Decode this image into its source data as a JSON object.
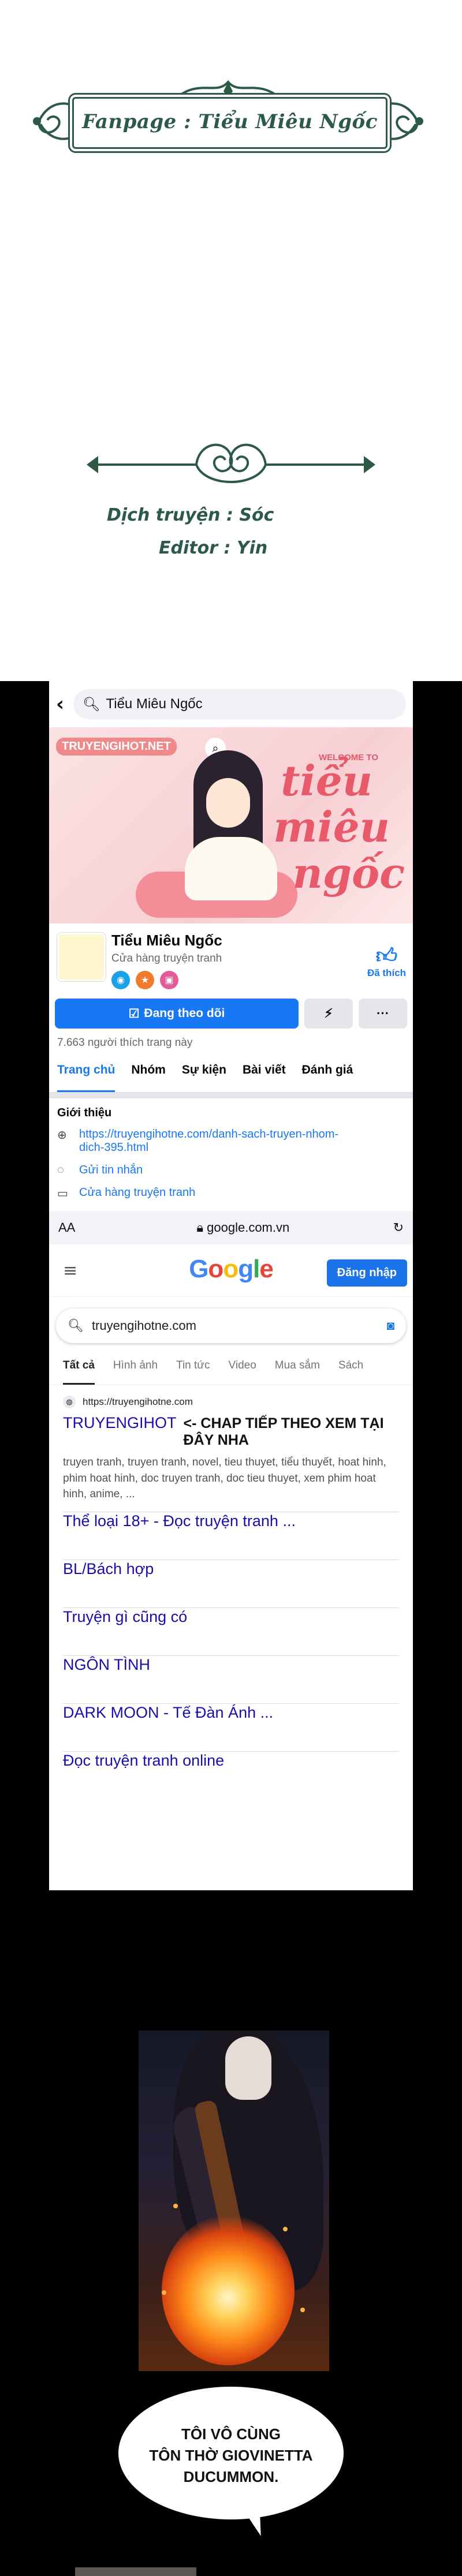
{
  "credits": {
    "fanpage": "Fanpage : Tiểu Miêu Ngốc",
    "translator": "Dịch truyện : Sóc",
    "editor": "Editor : Yin",
    "colors": {
      "ornament": "#2c5a46"
    }
  },
  "facebook": {
    "search_text": "Tiểu Miêu Ngốc",
    "cover": {
      "watermark": "TRUYENGIHOT.NET",
      "welcome": "WELCOME TO",
      "script_line1": "tiểu",
      "script_line2": "miêu",
      "script_line3": "ngốc"
    },
    "page_name": "Tiểu Miêu Ngốc",
    "category": "Cửa hàng truyện tranh",
    "like_label": "Đã thích",
    "follow_label": "Đang theo dõi",
    "more_label": "···",
    "likes_count": "7.663 người thích trang này",
    "tabs": [
      "Trang chủ",
      "Nhóm",
      "Sự kiện",
      "Bài viết",
      "Đánh giá"
    ],
    "intro_heading": "Giới thiệu",
    "intro_link_line1": "https://truyengihotne.com/danh-sach-truyen-nhom-",
    "intro_link_line2": "dich-395.html",
    "message_label": "Gửi tin nhắn",
    "store_label": "Cửa hàng truyện tranh",
    "colors": {
      "brand_blue": "#1877f2"
    }
  },
  "browser": {
    "aa_label": "AA",
    "url": "google.com.vn"
  },
  "google": {
    "logo": "Google",
    "login_label": "Đăng nhập",
    "query": "truyengihotne.com",
    "tabs": [
      "Tất cả",
      "Hình ảnh",
      "Tin tức",
      "Video",
      "Mua sắm",
      "Sách"
    ],
    "result_site": "https://truyengihotne.com",
    "result_title": "TRUYENGIHOT",
    "result_overlay": "<- CHAP TIẾP THEO XEM TẠI ĐÂY NHA",
    "snippet": "truyen tranh, truyen tranh, novel, tieu thuyet, tiểu thuyết, hoat hinh, phim hoat hinh, doc truyen tranh, doc tieu thuyet, xem phim hoat hinh, anime, ...",
    "sitelinks": [
      "Thể loại 18+ - Đọc truyện tranh ...",
      "BL/Bách hợp",
      "Truyện gì cũng có",
      "NGÔN TÌNH",
      "DARK MOON - Tế Đàn Ánh ...",
      "Đọc truyện tranh online"
    ],
    "colors": {
      "link": "#1a0dab",
      "logo_blue": "#4285f4",
      "logo_red": "#ea4335",
      "logo_yellow": "#fbbc05",
      "logo_green": "#34a853"
    }
  },
  "comic": {
    "speech_line1": "TÔI VÔ CÙNG",
    "speech_line2": "TÔN THỜ GIOVINETTA",
    "speech_line3": "DUCUMMON."
  }
}
